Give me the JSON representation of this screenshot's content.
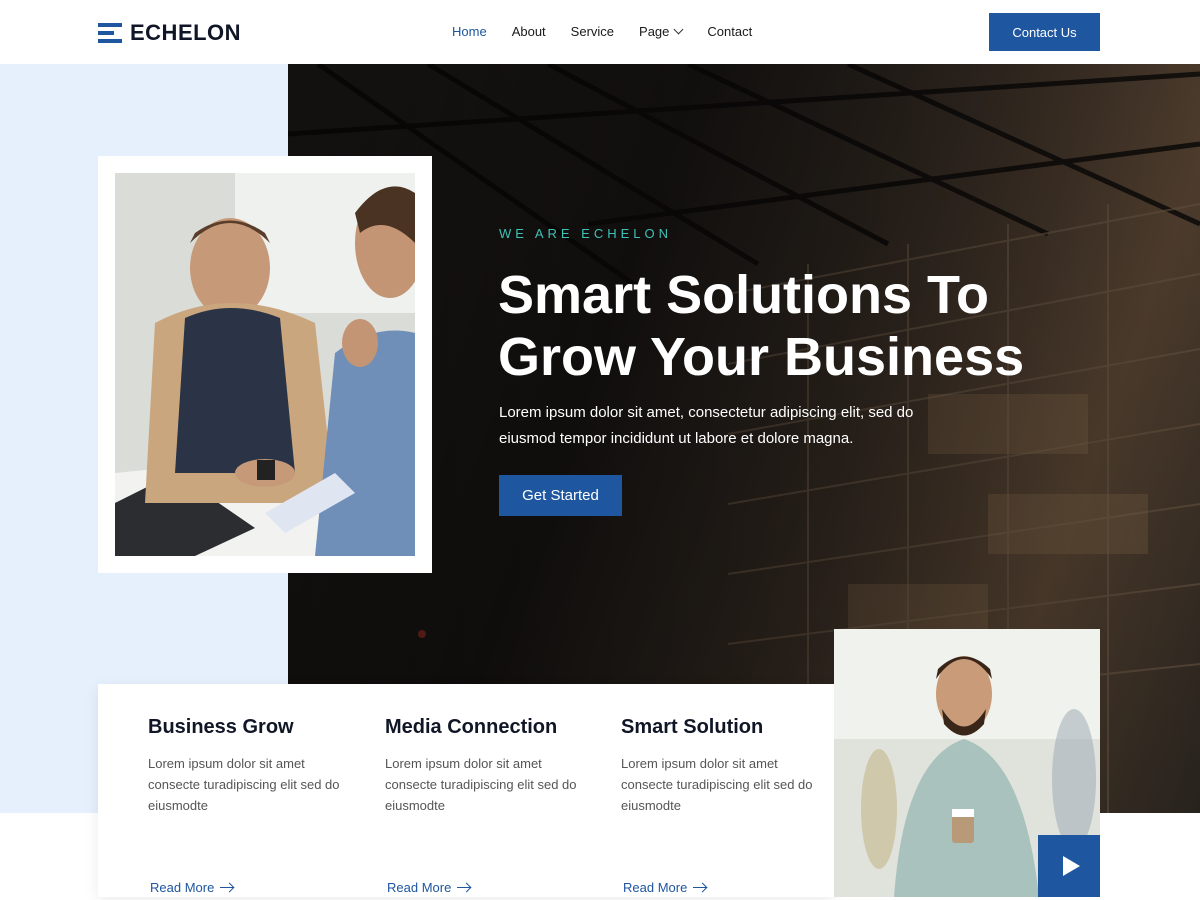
{
  "header": {
    "logo_text": "ECHELON",
    "nav": [
      {
        "label": "Home",
        "active": true
      },
      {
        "label": "About"
      },
      {
        "label": "Service"
      },
      {
        "label": "Page",
        "has_dropdown": true
      },
      {
        "label": "Contact"
      }
    ],
    "contact_button": "Contact Us"
  },
  "hero": {
    "eyebrow": "WE ARE ECHELON",
    "headline": "Smart Solutions To Grow Your Business",
    "subtitle": "Lorem ipsum dolor sit amet, consectetur adipiscing elit, sed do eiusmod tempor incididunt ut labore et dolore magna.",
    "cta": "Get Started"
  },
  "features": [
    {
      "title": "Business Grow",
      "text": "Lorem ipsum dolor sit amet consecte turadipiscing elit sed do eiusmodte",
      "link": "Read More"
    },
    {
      "title": "Media Connection",
      "text": "Lorem ipsum dolor sit amet consecte turadipiscing elit sed do eiusmodte",
      "link": "Read More"
    },
    {
      "title": "Smart Solution",
      "text": "Lorem ipsum dolor sit amet consecte turadipiscing elit sed do eiusmodte",
      "link": "Read More"
    }
  ],
  "colors": {
    "brand": "#1f56a0",
    "accent_teal": "#3fc1b6",
    "light_band": "#e6f0fd"
  },
  "icons": {
    "play": "play-icon",
    "arrow": "arrow-right-icon",
    "dropdown": "chevron-down-icon"
  }
}
